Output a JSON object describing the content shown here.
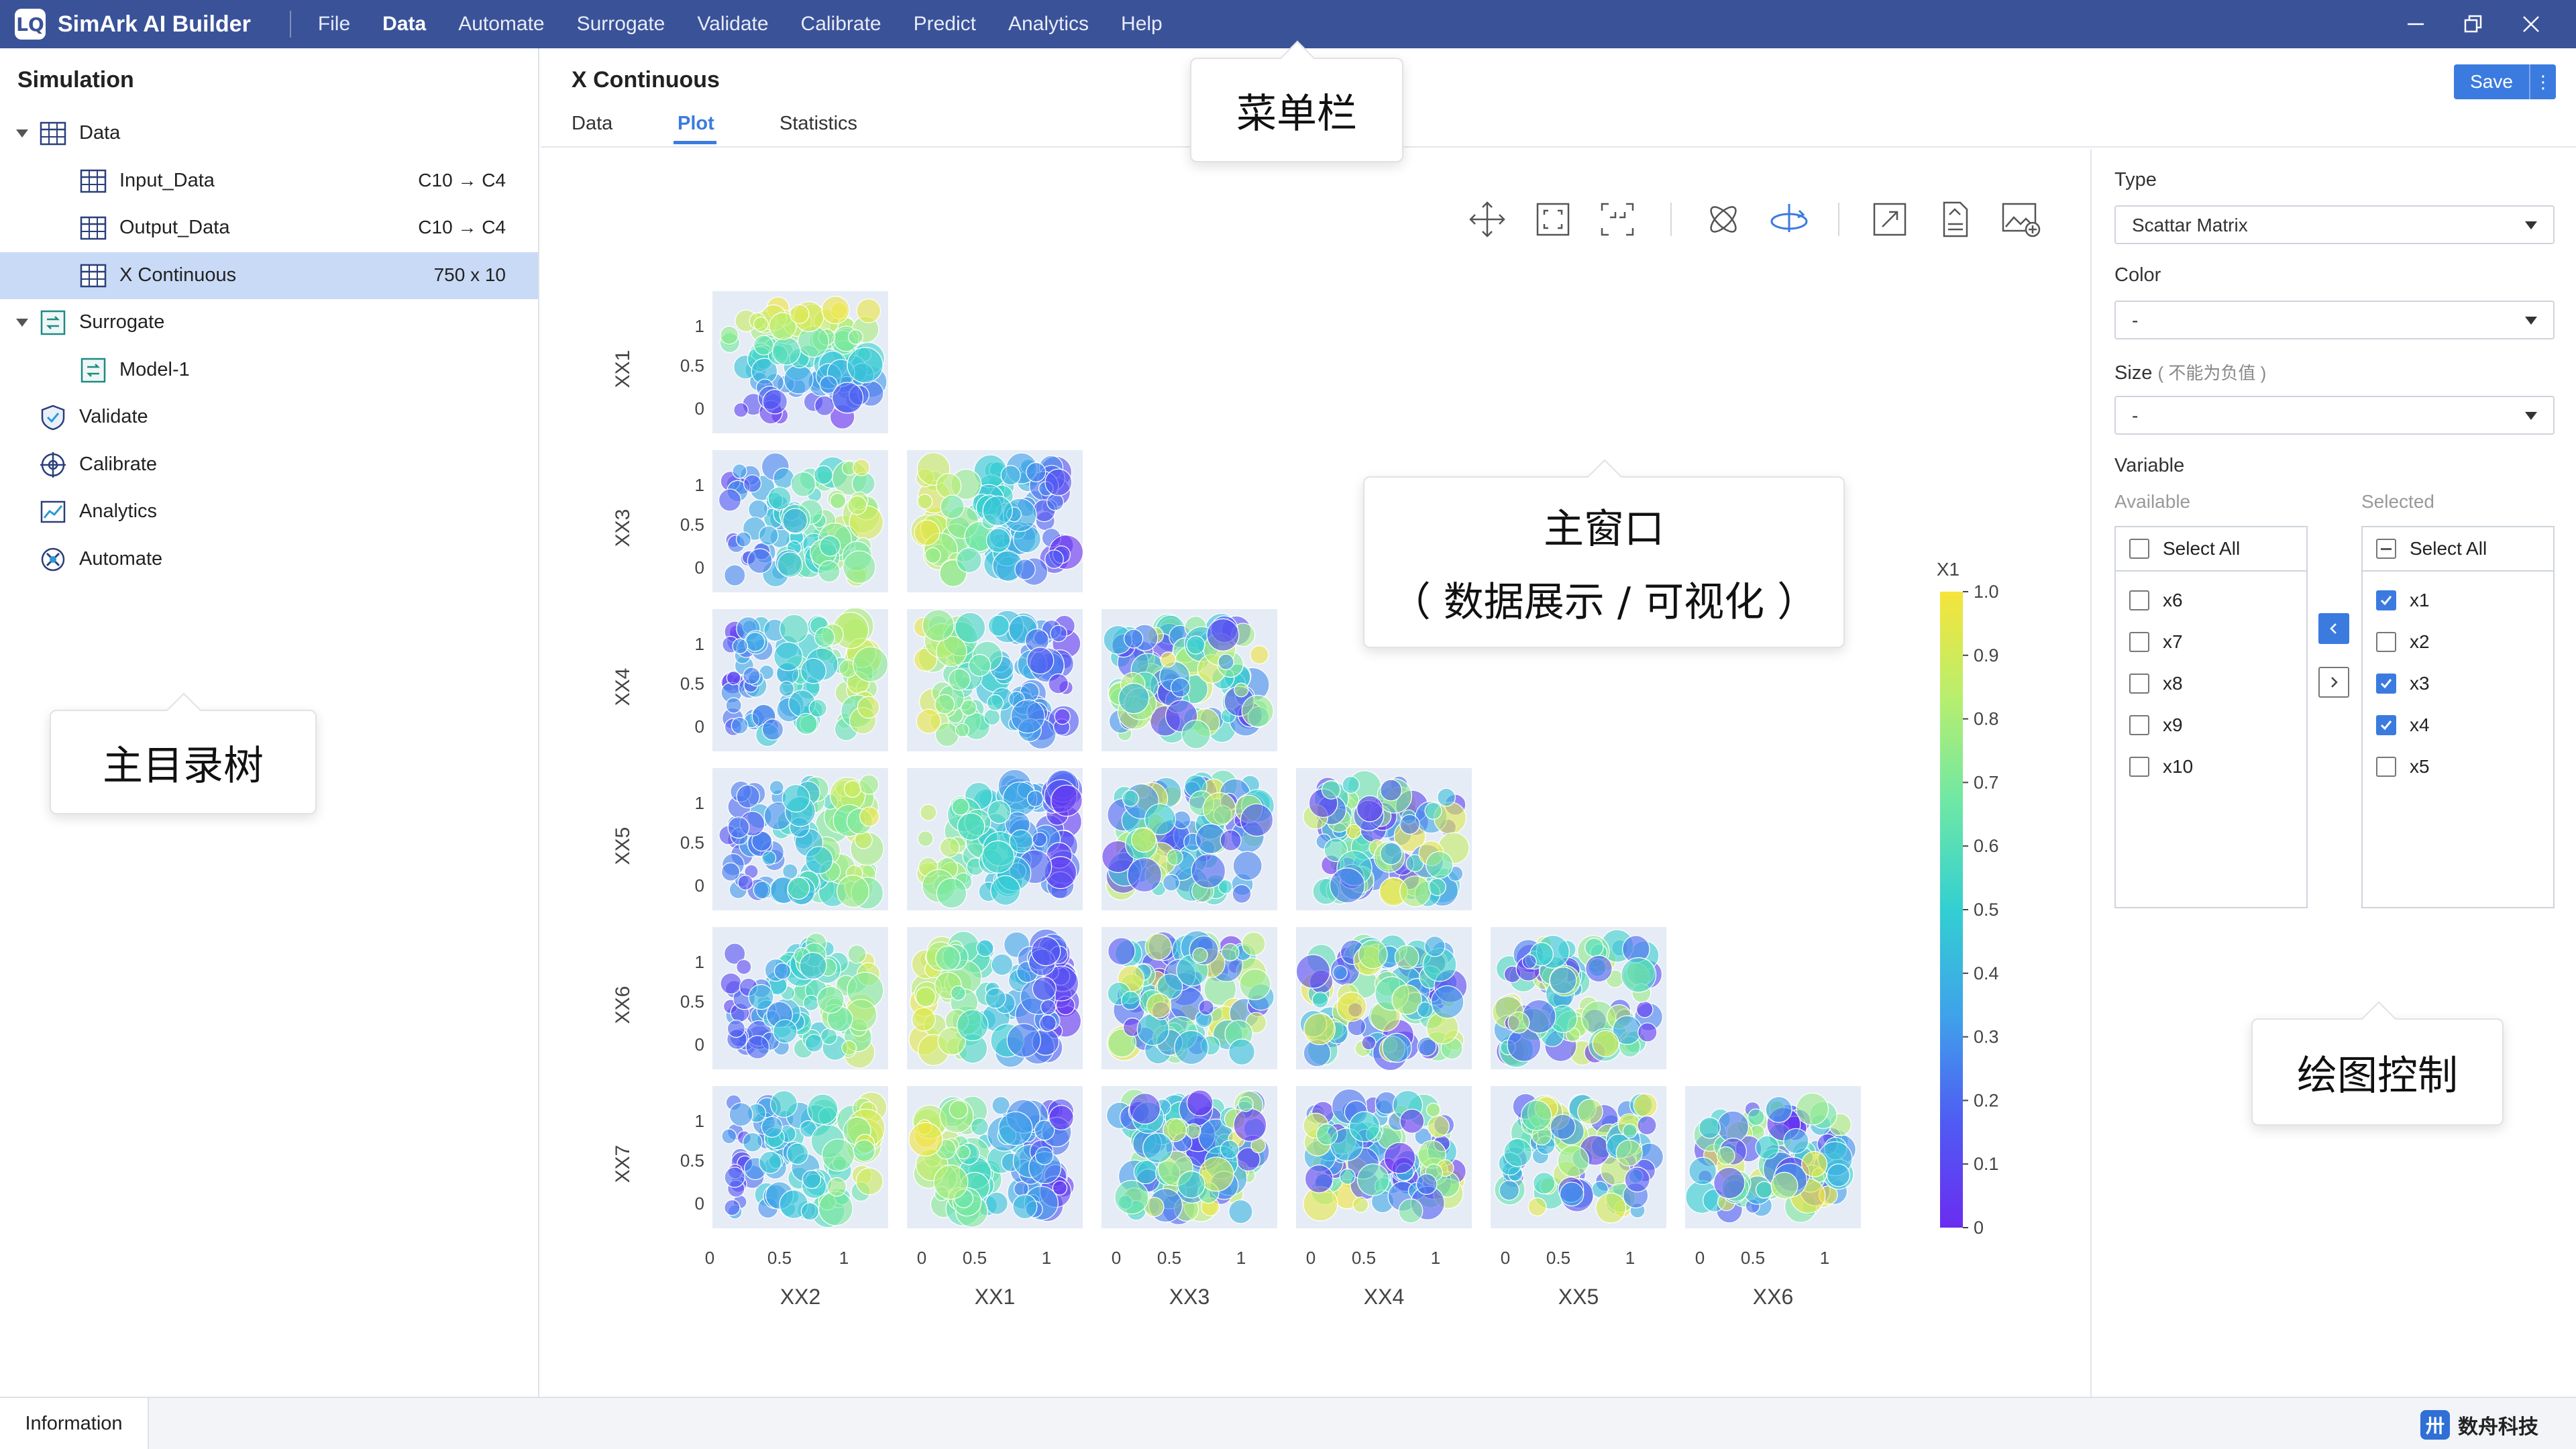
{
  "app": {
    "title": "SimArk AI Builder",
    "logo_text": "LQ",
    "menu": [
      "File",
      "Data",
      "Automate",
      "Surrogate",
      "Validate",
      "Calibrate",
      "Predict",
      "Analytics",
      "Help"
    ],
    "active_menu": "Data"
  },
  "sidebar": {
    "title": "Simulation",
    "items": [
      {
        "label": "Data",
        "meta": "",
        "icon": "table-icon",
        "expandable": true,
        "level": 0
      },
      {
        "label": "Input_Data",
        "meta": "C10 → C4",
        "icon": "table-icon",
        "level": 1
      },
      {
        "label": "Output_Data",
        "meta": "C10 → C4",
        "icon": "table-icon",
        "level": 1
      },
      {
        "label": "X Continuous",
        "meta": "750 x 10",
        "icon": "table-icon",
        "level": 1,
        "selected": true
      },
      {
        "label": "Surrogate",
        "meta": "",
        "icon": "surrogate-icon",
        "expandable": true,
        "level": 0
      },
      {
        "label": "Model-1",
        "meta": "",
        "icon": "model-icon",
        "level": 1
      },
      {
        "label": "Validate",
        "meta": "",
        "icon": "shield-icon",
        "level": 0
      },
      {
        "label": "Calibrate",
        "meta": "",
        "icon": "crosshair-icon",
        "level": 0
      },
      {
        "label": "Analytics",
        "meta": "",
        "icon": "chart-icon",
        "level": 0
      },
      {
        "label": "Automate",
        "meta": "",
        "icon": "automate-icon",
        "level": 0
      }
    ]
  },
  "header": {
    "title": "X Continuous",
    "tabs": [
      "Data",
      "Plot",
      "Statistics"
    ],
    "active_tab": "Plot",
    "save_label": "Save",
    "more_label": "⋮"
  },
  "toolbar_icons": [
    "pan-icon",
    "zoom-in-icon",
    "zoom-out-icon",
    "autoscale-icon",
    "orbit-rotate-icon",
    "reset-icon",
    "export-icon",
    "snapshot-icon"
  ],
  "chart_data": {
    "type": "scatter",
    "subtype": "scatter_matrix",
    "columns": [
      "XX2",
      "XX1",
      "XX3",
      "XX4",
      "XX5",
      "XX6"
    ],
    "rows": [
      "XX1",
      "XX3",
      "XX4",
      "XX5",
      "XX6",
      "XX7"
    ],
    "tick_labels": [
      "0",
      "0.5",
      "1"
    ],
    "axis_range": [
      0,
      1
    ],
    "color_variable": "X1",
    "colorbar": {
      "title": "X1",
      "ticks": [
        "0",
        "0.1",
        "0.2",
        "0.3",
        "0.4",
        "0.5",
        "0.6",
        "0.7",
        "0.8",
        "0.9",
        "1.0"
      ],
      "range": [
        0,
        1
      ],
      "colors": [
        "#6a2cf0",
        "#4f5cf3",
        "#3fa2ea",
        "#33cfd2",
        "#6ee7a6",
        "#b8ee6e",
        "#f6e43a"
      ]
    },
    "layout": "lower-triangle",
    "panel_background": "#e5ecf6"
  },
  "panel": {
    "type_label": "Type",
    "type_value": "Scattar Matrix",
    "color_label": "Color",
    "color_value": "-",
    "size_label": "Size",
    "size_hint": "( 不能为负值 )",
    "size_value": "-",
    "variable_label": "Variable",
    "available_label": "Available",
    "selected_label": "Selected",
    "select_all": "Select All",
    "available": [
      {
        "label": "x6",
        "checked": false
      },
      {
        "label": "x7",
        "checked": false
      },
      {
        "label": "x8",
        "checked": false
      },
      {
        "label": "x9",
        "checked": false
      },
      {
        "label": "x10",
        "checked": false
      }
    ],
    "selected": [
      {
        "label": "x1",
        "checked": true
      },
      {
        "label": "x2",
        "checked": false
      },
      {
        "label": "x3",
        "checked": true
      },
      {
        "label": "x4",
        "checked": true
      },
      {
        "label": "x5",
        "checked": false
      }
    ]
  },
  "status": {
    "info_tab": "Information",
    "brand": "数舟科技",
    "brand_logo": "卅"
  },
  "callouts": {
    "menu": "菜单栏",
    "tree": "主目录树",
    "main_line1": "主窗口",
    "main_line2": "（ 数据展示 / 可视化 ）",
    "control": "绘图控制"
  },
  "colors": {
    "titlebar": "#3a5298",
    "accent": "#3b7be0",
    "selection": "#c9daf6"
  }
}
